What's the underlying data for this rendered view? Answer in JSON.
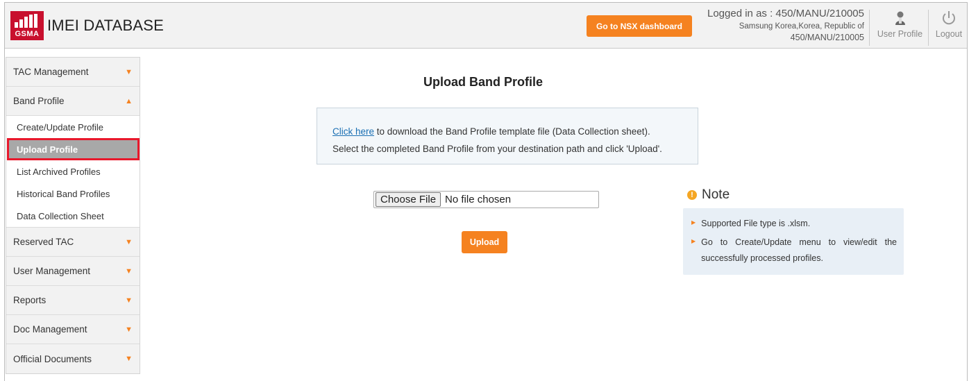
{
  "header": {
    "logo_text": "GSMA",
    "app_title": "IMEI DATABASE",
    "nsx_button": "Go to NSX dashboard",
    "login_line1": "Logged in as : 450/MANU/210005",
    "login_line2": "Samsung Korea,Korea, Republic of",
    "login_line3": "450/MANU/210005",
    "user_profile": "User Profile",
    "logout": "Logout"
  },
  "sidebar": {
    "tac_management": "TAC Management",
    "band_profile": "Band Profile",
    "sub_items": [
      "Create/Update Profile",
      "Upload Profile",
      "List Archived Profiles",
      "Historical Band Profiles",
      "Data Collection Sheet"
    ],
    "reserved_tac": "Reserved TAC",
    "user_management": "User Management",
    "reports": "Reports",
    "doc_management": "Doc Management",
    "official_documents": "Official Documents"
  },
  "main": {
    "title": "Upload Band Profile",
    "link_text": "Click here",
    "info_line1_rest": " to download the Band Profile template file (Data Collection sheet).",
    "info_line2": "Select the completed Band Profile from your destination path and click 'Upload'.",
    "choose_file": "Choose File",
    "no_file": "No file chosen",
    "upload_button": "Upload"
  },
  "note": {
    "title": "Note",
    "items": [
      "Supported File type is .xlsm.",
      "Go to Create/Update menu to view/edit the successfully processed profiles."
    ]
  },
  "colors": {
    "accent": "#f58220",
    "brand": "#c8102e",
    "highlight": "#e8182c"
  }
}
